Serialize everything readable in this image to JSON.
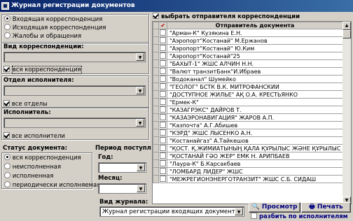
{
  "window": {
    "title": "Журнал регистрации документов"
  },
  "corr_type": {
    "options": [
      {
        "label": "Входящая корреспонденция",
        "selected": true
      },
      {
        "label": "Исходящая корреспонденция",
        "selected": false
      },
      {
        "label": "Жалобы и обращения",
        "selected": false
      }
    ]
  },
  "kind": {
    "label": "Вид корреспонденции:",
    "value": "",
    "all_label": "вся корреспонденция",
    "all_checked": true
  },
  "dept": {
    "label": "Отдел исполнителя:",
    "value": "",
    "all_label": "все отделы",
    "all_checked": true
  },
  "executor": {
    "label": "Исполнитель:",
    "value": "",
    "all_label": "все исполнители",
    "all_checked": true
  },
  "status": {
    "label": "Статус документа:",
    "options": [
      {
        "label": "вся корреспонденция",
        "selected": true
      },
      {
        "label": "неисполненная",
        "selected": false
      },
      {
        "label": "исполненная",
        "selected": false
      },
      {
        "label": "периодически исполняемая",
        "selected": false
      }
    ]
  },
  "period": {
    "label": "Период поступлени",
    "year_label": "Год:",
    "year_value": "",
    "month_label": "Месяц:",
    "month_value": ""
  },
  "journal": {
    "label": "Вид журнала:",
    "value": "Журнал регистрации входящих документов"
  },
  "senders": {
    "select_label": "выбрать отправителя корреспонденции",
    "select_checked": true,
    "col_check_glyph": "✔",
    "col_check_color": "#c00000",
    "column": "Отправитель документа",
    "rows": [
      "\"Арман-К\" Кузякина Е.Н.",
      "\"Аэропорт\"Костанай\" М.Ержанов",
      "\"Аэропорт\"Костанай\" Ю.Ким",
      "\"Аэропорт\"Костанай\"25",
      "\"БАХЫТ-1\" ЖШС АЛЧИН Н.Н.",
      "\"Валют транзитБанк\"И.Ибраев",
      "\"Водоканал\" Шумейко",
      "\"ГЕОЛОГ\" БСТК В.К. МИТРОФАНСКИИ",
      "\"ДОСТУПНОЕ ЖИЛЬЕ\" АҚ О.А. КРЕСТЬЯНКО",
      "\"Ермек-К\"",
      "\"КАЗАГРЭКС\" ДАЙРОВ Т.",
      "\"КАЗАЭРОНАВИГАЦИЯ\" ЖАРОВ А.П.",
      "\"Казпочта\" А.Г.Абишев",
      "\"КЭРД\" ЖШС ЛЫСЕНКО А.Н.",
      "\"Костанайгаз\" А.Тайкешов",
      "\"ҚОСТ. Қ.ЖИМИАТЫНЫҢ ҚАЛА ҚҰРЫЛЫС ЖӘНЕ ҚҰРЫЛЫС БӨ",
      "\"ҚОСТАНАЙ ГӘО ЖЕР\" ЕМК Н. АРИПБАЕВ",
      "\"Лаура-К\" Б.Карсакбаев",
      "\"ЛОМБАРД   ЛИДЕР\" ЖШС",
      "\"МЕЖРЕГИОНЭНЕРГОТРАНЗИТ\" ЖШС С.Б. СИДАШ"
    ]
  },
  "actions": {
    "preview": "Просмотр",
    "print": "Печать",
    "split_label": "разбить по исполнителям",
    "split_checked": false
  }
}
